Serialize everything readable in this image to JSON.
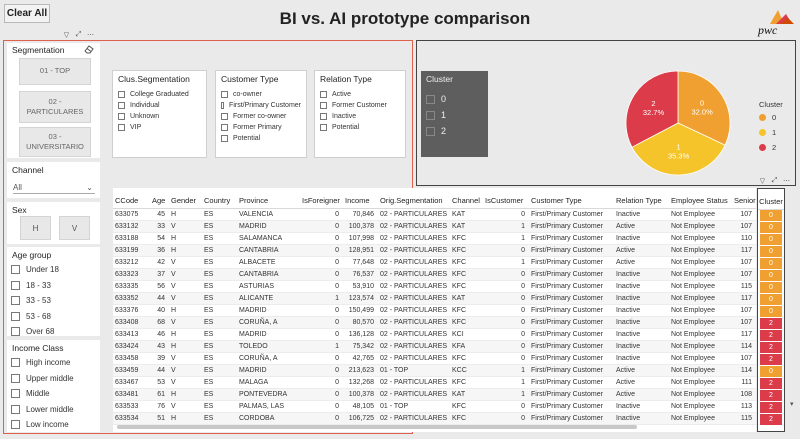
{
  "toolbar": {
    "clear_all": "Clear All"
  },
  "report": {
    "title": "BI vs. AI prototype comparison",
    "logo_text": "pwc"
  },
  "colors": {
    "cluster0": "#f0a030",
    "cluster1": "#f5c42a",
    "cluster2": "#dc3b4a",
    "frame_red": "#e0614b"
  },
  "segmentation": {
    "title": "Segmentation",
    "buttons": [
      "01 - TOP",
      "02 - PARTICULARES",
      "03 - UNIVERSITARIO"
    ]
  },
  "clus_segmentation": {
    "title": "Clus.Segmentation",
    "items": [
      "College Graduated",
      "Individual",
      "Unknown",
      "VIP"
    ]
  },
  "customer_type": {
    "title": "Customer Type",
    "items": [
      "co-owner",
      "First/Primary Customer",
      "Former co-owner",
      "Former Primary",
      "Potential"
    ]
  },
  "relation_type": {
    "title": "Relation Type",
    "items": [
      "Active",
      "Former Customer",
      "Inactive",
      "Potential"
    ]
  },
  "cluster_slicer": {
    "title": "Cluster",
    "items": [
      "0",
      "1",
      "2"
    ]
  },
  "channel": {
    "title": "Channel",
    "value": "All"
  },
  "sex": {
    "title": "Sex",
    "options": [
      "H",
      "V"
    ]
  },
  "age_group": {
    "title": "Age group",
    "items": [
      "Under 18",
      "18 - 33",
      "33 - 53",
      "53 - 68",
      "Over 68"
    ]
  },
  "income_class": {
    "title": "Income Class",
    "items": [
      "High income",
      "Upper middle",
      "Middle",
      "Lower middle",
      "Low income"
    ]
  },
  "chart_data": {
    "type": "pie",
    "slices": [
      {
        "label": "0",
        "pct_label": "32.0%",
        "value": 32.0,
        "color": "#f0a030"
      },
      {
        "label": "1",
        "pct_label": "35.3%",
        "value": 35.3,
        "color": "#f5c42a"
      },
      {
        "label": "2",
        "pct_label": "32.7%",
        "value": 32.7,
        "color": "#dc3b4a"
      }
    ],
    "legend": {
      "title": "Cluster",
      "entries": [
        "0",
        "1",
        "2"
      ],
      "placement": "right"
    }
  },
  "table": {
    "columns": [
      "CCode",
      "Age",
      "Gender",
      "Country",
      "Province",
      "IsForeigner",
      "Income",
      "Orig.Segmentation",
      "Channel",
      "IsCustomer",
      "Customer Type",
      "Relation Type",
      "Employee Status",
      "Seniority"
    ],
    "cluster_header": "Cluster",
    "rows": [
      [
        "633075",
        "45",
        "H",
        "ES",
        "VALENCIA",
        "0",
        "70,846",
        "02 - PARTICULARES",
        "KAT",
        "0",
        "First/Primary Customer",
        "Inactive",
        "Not Employee",
        "107"
      ],
      [
        "633132",
        "33",
        "V",
        "ES",
        "MADRID",
        "0",
        "100,378",
        "02 - PARTICULARES",
        "KAT",
        "1",
        "First/Primary Customer",
        "Active",
        "Not Employee",
        "107"
      ],
      [
        "633188",
        "54",
        "H",
        "ES",
        "SALAMANCA",
        "0",
        "107,998",
        "02 - PARTICULARES",
        "KFC",
        "1",
        "First/Primary Customer",
        "Inactive",
        "Not Employee",
        "110"
      ],
      [
        "633199",
        "36",
        "H",
        "ES",
        "CANTABRIA",
        "0",
        "128,951",
        "02 - PARTICULARES",
        "KFC",
        "0",
        "First/Primary Customer",
        "Active",
        "Not Employee",
        "117"
      ],
      [
        "633212",
        "42",
        "V",
        "ES",
        "ALBACETE",
        "0",
        "77,648",
        "02 - PARTICULARES",
        "KFC",
        "1",
        "First/Primary Customer",
        "Active",
        "Not Employee",
        "107"
      ],
      [
        "633323",
        "37",
        "V",
        "ES",
        "CANTABRIA",
        "0",
        "76,537",
        "02 - PARTICULARES",
        "KFC",
        "0",
        "First/Primary Customer",
        "Inactive",
        "Not Employee",
        "107"
      ],
      [
        "633335",
        "56",
        "V",
        "ES",
        "ASTURIAS",
        "0",
        "53,910",
        "02 - PARTICULARES",
        "KFC",
        "0",
        "First/Primary Customer",
        "Inactive",
        "Not Employee",
        "115"
      ],
      [
        "633352",
        "44",
        "V",
        "ES",
        "ALICANTE",
        "1",
        "123,574",
        "02 - PARTICULARES",
        "KAT",
        "0",
        "First/Primary Customer",
        "Inactive",
        "Not Employee",
        "117"
      ],
      [
        "633376",
        "40",
        "H",
        "ES",
        "MADRID",
        "0",
        "150,499",
        "02 - PARTICULARES",
        "KFC",
        "0",
        "First/Primary Customer",
        "Inactive",
        "Not Employee",
        "107"
      ],
      [
        "633408",
        "68",
        "V",
        "ES",
        "CORUÑA, A",
        "0",
        "80,570",
        "02 - PARTICULARES",
        "KFC",
        "0",
        "First/Primary Customer",
        "Inactive",
        "Not Employee",
        "107"
      ],
      [
        "633413",
        "46",
        "H",
        "ES",
        "MADRID",
        "0",
        "136,128",
        "02 - PARTICULARES",
        "KCI",
        "0",
        "First/Primary Customer",
        "Inactive",
        "Not Employee",
        "117"
      ],
      [
        "633424",
        "43",
        "H",
        "ES",
        "TOLEDO",
        "1",
        "75,342",
        "02 - PARTICULARES",
        "KFA",
        "0",
        "First/Primary Customer",
        "Inactive",
        "Not Employee",
        "114"
      ],
      [
        "633458",
        "39",
        "V",
        "ES",
        "CORUÑA, A",
        "0",
        "42,765",
        "02 - PARTICULARES",
        "KFC",
        "0",
        "First/Primary Customer",
        "Inactive",
        "Not Employee",
        "107"
      ],
      [
        "633459",
        "44",
        "V",
        "ES",
        "MADRID",
        "0",
        "213,623",
        "01 - TOP",
        "KCC",
        "1",
        "First/Primary Customer",
        "Active",
        "Not Employee",
        "114"
      ],
      [
        "633467",
        "53",
        "V",
        "ES",
        "MALAGA",
        "0",
        "132,268",
        "02 - PARTICULARES",
        "KFC",
        "1",
        "First/Primary Customer",
        "Active",
        "Not Employee",
        "111"
      ],
      [
        "633481",
        "61",
        "H",
        "ES",
        "PONTEVEDRA",
        "0",
        "100,378",
        "02 - PARTICULARES",
        "KAT",
        "1",
        "First/Primary Customer",
        "Active",
        "Not Employee",
        "108"
      ],
      [
        "633533",
        "76",
        "V",
        "ES",
        "PALMAS, LAS",
        "0",
        "48,105",
        "01 - TOP",
        "KFC",
        "0",
        "First/Primary Customer",
        "Inactive",
        "Not Employee",
        "113"
      ],
      [
        "633534",
        "51",
        "H",
        "ES",
        "CORDOBA",
        "0",
        "106,725",
        "02 - PARTICULARES",
        "KFC",
        "0",
        "First/Primary Customer",
        "Inactive",
        "Not Employee",
        "115"
      ]
    ],
    "clusters": [
      "0",
      "0",
      "0",
      "0",
      "0",
      "0",
      "0",
      "0",
      "0",
      "2",
      "2",
      "2",
      "2",
      "0",
      "2",
      "2",
      "2",
      "2"
    ]
  }
}
